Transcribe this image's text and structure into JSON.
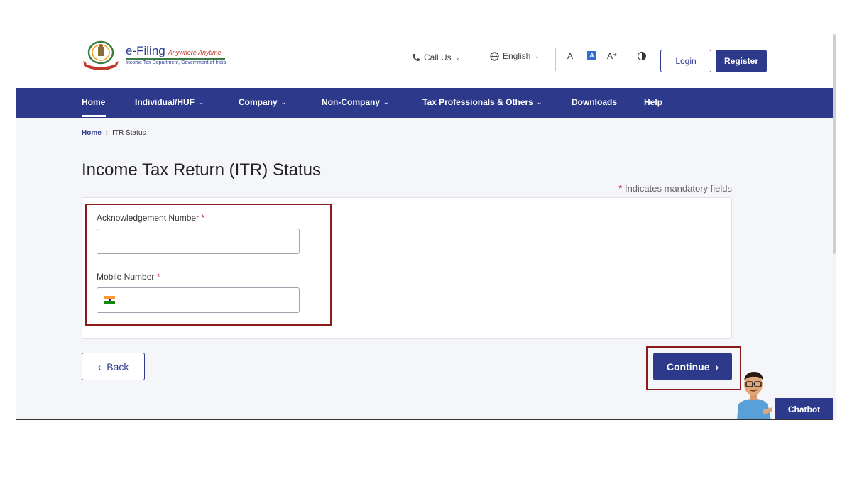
{
  "header": {
    "logo_title": "e-Filing",
    "logo_tagline": "Anywhere Anytime",
    "logo_subtitle": "Income Tax Department, Government of India",
    "call_us": "Call Us",
    "language": "English",
    "font_decrease": "A⁻",
    "font_default": "A",
    "font_increase": "A⁺",
    "login_label": "Login",
    "register_label": "Register"
  },
  "nav": {
    "items": [
      {
        "label": "Home"
      },
      {
        "label": "Individual/HUF"
      },
      {
        "label": "Company"
      },
      {
        "label": "Non-Company"
      },
      {
        "label": "Tax Professionals & Others"
      },
      {
        "label": "Downloads"
      },
      {
        "label": "Help"
      }
    ]
  },
  "breadcrumb": {
    "home": "Home",
    "separator": "›",
    "current": "ITR Status"
  },
  "main": {
    "title": "Income Tax Return (ITR) Status",
    "mandatory_star": "*",
    "mandatory_text": "Indicates mandatory fields",
    "fields": [
      {
        "label": "Acknowledgement Number",
        "required_mark": "*",
        "value": ""
      },
      {
        "label": "Mobile Number",
        "required_mark": "*",
        "value": ""
      }
    ],
    "back_label": "Back",
    "continue_label": "Continue"
  },
  "chatbot": {
    "label": "Chatbot"
  },
  "colors": {
    "brand": "#2d3a8c",
    "highlight": "#8b1a1a",
    "required": "#d0021b"
  },
  "icons": [
    "phone-icon",
    "globe-icon",
    "contrast-icon",
    "chevron-left-icon",
    "chevron-right-icon",
    "india-flag-icon",
    "emblem-icon",
    "chatbot-avatar-icon"
  ]
}
